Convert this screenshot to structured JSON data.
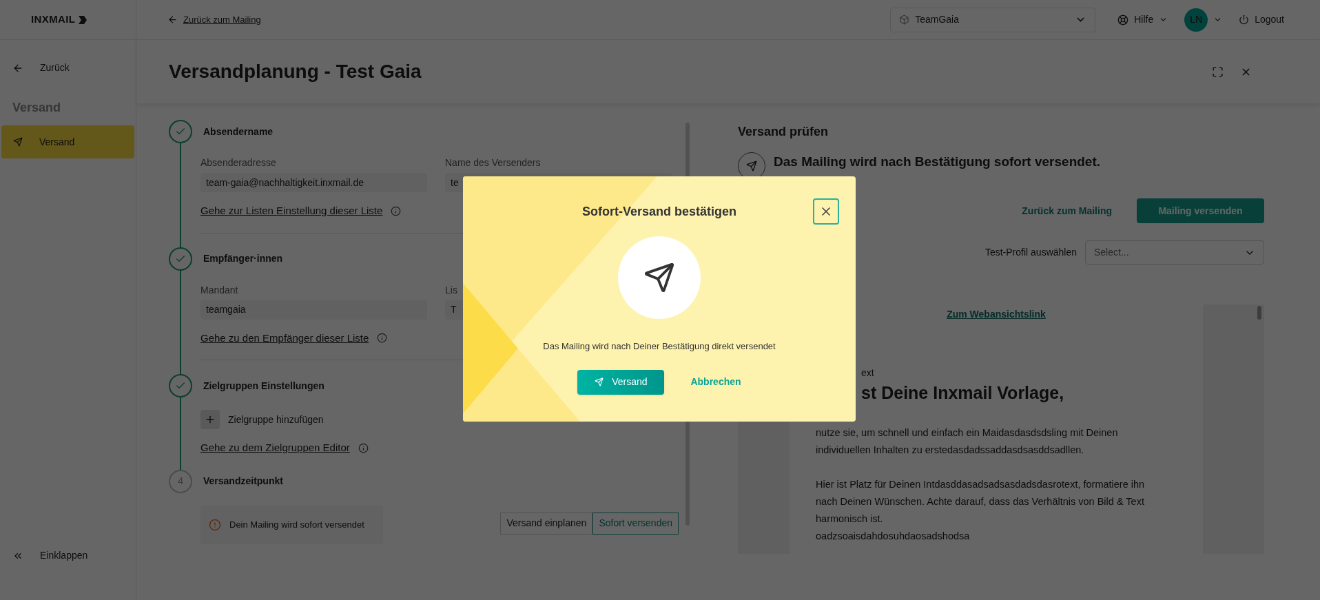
{
  "topbar": {
    "logo": "INXMAIL",
    "back_link": "Zurück zum Mailing",
    "workspace": "TeamGaia",
    "help": "Hilfe",
    "avatar": "LN",
    "logout": "Logout"
  },
  "sidebar": {
    "back": "Zurück",
    "section": "Versand",
    "items": [
      {
        "label": "Versand",
        "selected": true
      }
    ],
    "collapse": "Einklappen"
  },
  "page": {
    "title": "Versandplanung - Test Gaia"
  },
  "steps": [
    {
      "kind": "done",
      "title": "Absendername",
      "fields": [
        {
          "label": "Absenderadresse",
          "value": "team-gaia@nachhaltigkeit.inxmail.de"
        },
        {
          "label": "Name des Versenders",
          "value": "te"
        }
      ],
      "link": "Gehe zur Listen Einstellung dieser Liste"
    },
    {
      "kind": "done",
      "title": "Empfänger·innen",
      "fields": [
        {
          "label": "Mandant",
          "value": "teamgaia"
        },
        {
          "label": "Lis",
          "value": "T"
        }
      ],
      "link": "Gehe zu den Empfänger dieser Liste"
    },
    {
      "kind": "done",
      "title": "Zielgruppen Einstellungen",
      "add_button": "Zielgruppe hinzufügen",
      "link": "Gehe zu dem Zielgruppen Editor"
    },
    {
      "kind": "pending",
      "number": "4",
      "title": "Versandzeitpunkt",
      "notice": "Dein Mailing wird sofort versendet",
      "options": [
        {
          "label": "Versand einplanen",
          "selected": false
        },
        {
          "label": "Sofort versenden",
          "selected": true
        }
      ]
    }
  ],
  "review": {
    "title": "Versand prüfen",
    "message": "Das Mailing wird nach Bestätigung sofort versendet.",
    "back_link": "Zurück zum Mailing",
    "send_button": "Mailing versenden",
    "profile_label": "Test-Profil auswählen",
    "profile_placeholder": "Select...",
    "preview": {
      "web_link": "Zum Webansichtslink",
      "pre_heading": "ext",
      "heading": "st Deine Inxmail Vorlage,",
      "paragraphs": [
        "nutze sie, um schnell und einfach ein Maidasdasdsdsling mit Deinen individuellen Inhalten zu erstedasdadssaddasdsasddsadllen.",
        "Hier ist Platz für Deinen Intdasddasadsadsasdadsdasrotext, formatiere ihn nach Deinen Wünschen. Achte darauf, dass das Verhältnis von Bild & Text harmonisch ist."
      ],
      "extra_line": "oadzsoaisdahdosuhdaosadshodsa"
    }
  },
  "dialog": {
    "title": "Sofort-Versand bestätigen",
    "message": "Das Mailing wird nach Deiner Bestätigung direkt versendet",
    "confirm": "Versand",
    "cancel": "Abbrechen"
  }
}
